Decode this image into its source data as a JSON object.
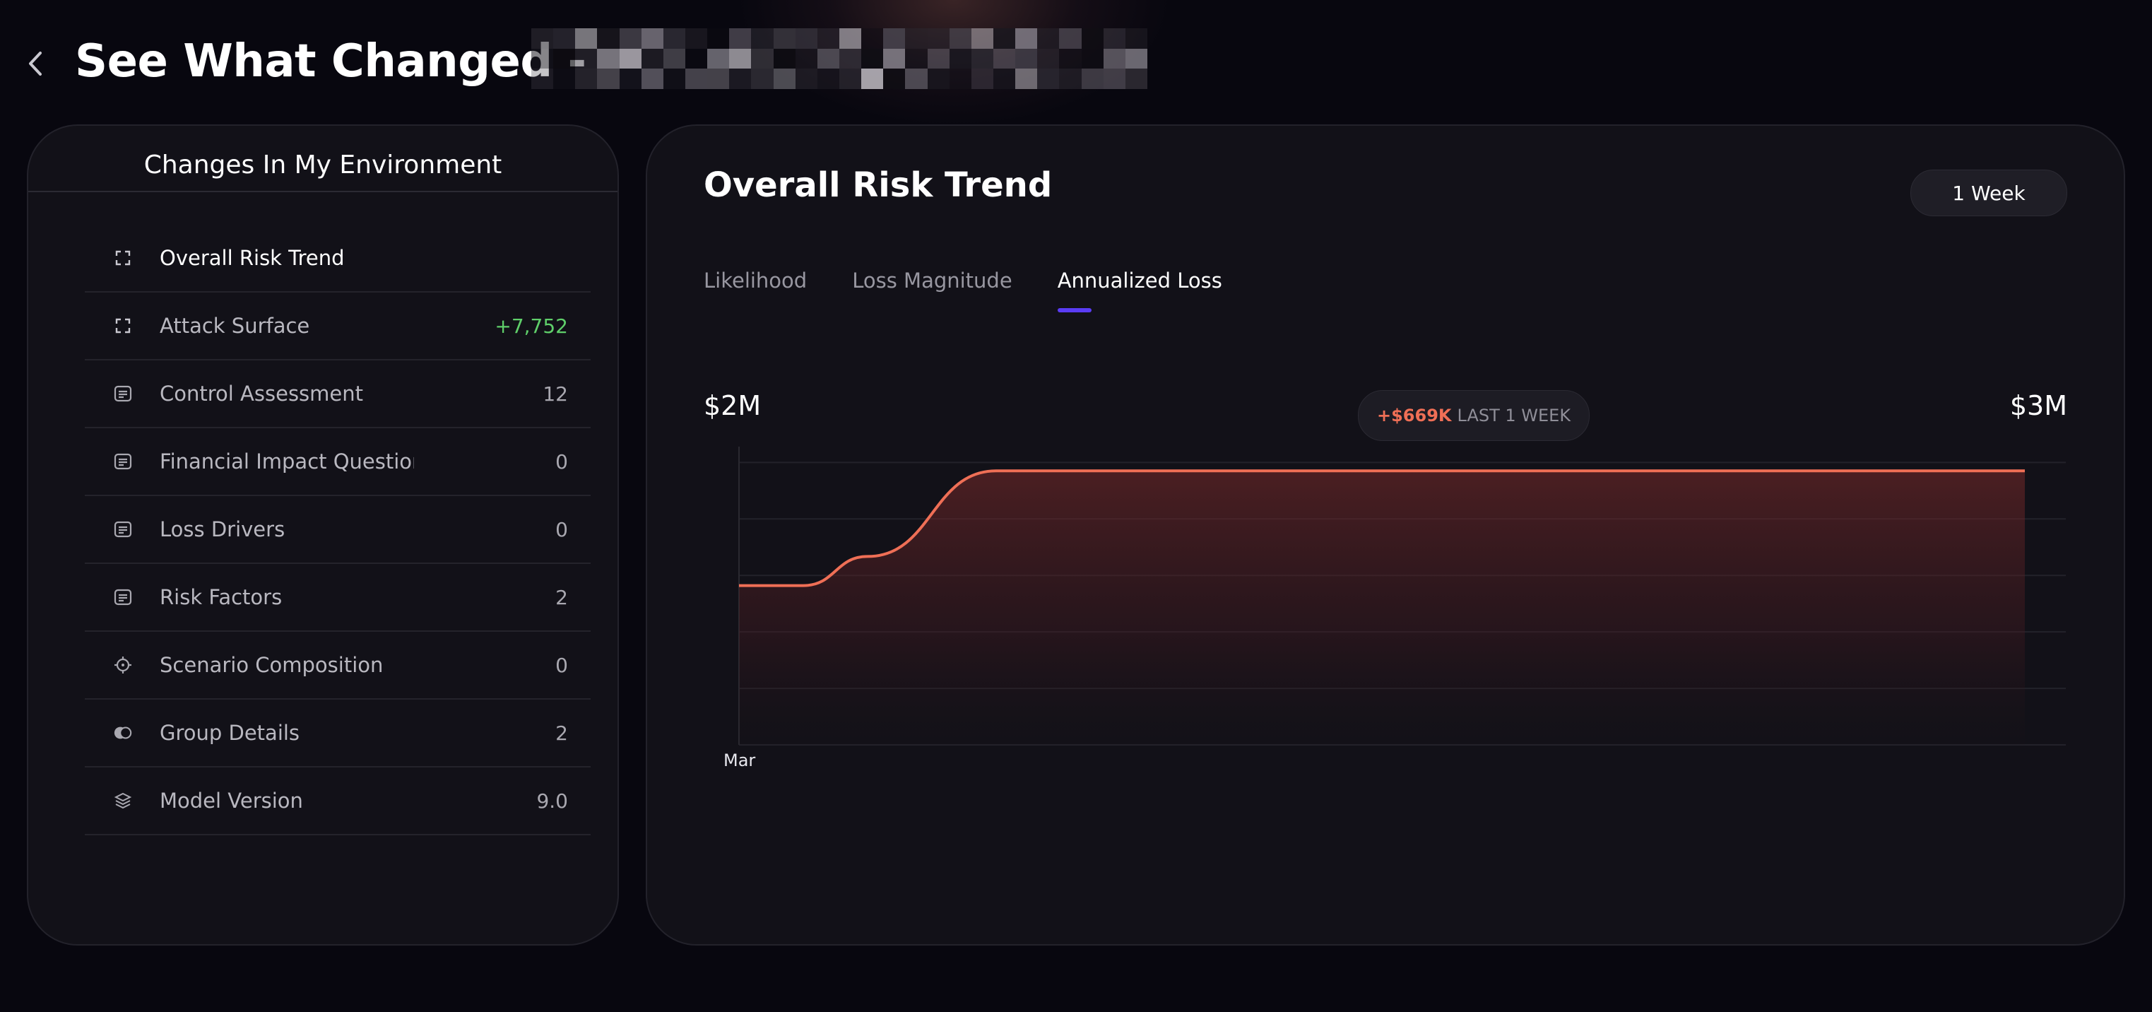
{
  "header": {
    "title": "See What Changed -"
  },
  "sidebar": {
    "title": "Changes In My Environment",
    "items": [
      {
        "label": "Overall Risk Trend",
        "value": "",
        "icon": "expand-icon",
        "active": true
      },
      {
        "label": "Attack Surface",
        "value": "+7,752",
        "icon": "expand-icon",
        "positive": true
      },
      {
        "label": "Control Assessment",
        "value": "12",
        "icon": "document-list-icon"
      },
      {
        "label": "Financial Impact Questionnaire",
        "value": "0",
        "icon": "document-list-icon"
      },
      {
        "label": "Loss Drivers",
        "value": "0",
        "icon": "document-list-icon"
      },
      {
        "label": "Risk Factors",
        "value": "2",
        "icon": "document-list-icon"
      },
      {
        "label": "Scenario Composition",
        "value": "0",
        "icon": "crosshair-icon"
      },
      {
        "label": "Group Details",
        "value": "2",
        "icon": "toggle-icon"
      },
      {
        "label": "Model Version",
        "value": "9.0",
        "icon": "layers-icon"
      }
    ]
  },
  "main": {
    "title": "Overall Risk Trend",
    "period": "1 Week",
    "tabs": [
      {
        "label": "Likelihood"
      },
      {
        "label": "Loss Magnitude"
      },
      {
        "label": "Annualized Loss",
        "active": true
      }
    ],
    "delta": {
      "value": "+$669K",
      "label": "LAST 1 WEEK"
    }
  },
  "colors": {
    "accent": "#5a3cf5",
    "line": "#ef6f56",
    "positive": "#5fcf6a"
  },
  "chart_data": {
    "type": "area",
    "y_start_label": "$2M",
    "y_end_label": "$3M",
    "x_tick_labels": [
      "Mar"
    ],
    "x": [
      0,
      0.05,
      0.1,
      0.2,
      0.3,
      0.4,
      0.5,
      0.6,
      0.7,
      0.8,
      0.9,
      1.0
    ],
    "values": [
      2.23,
      2.23,
      2.4,
      2.9,
      2.9,
      2.9,
      2.9,
      2.9,
      2.9,
      2.9,
      2.9,
      2.9
    ],
    "y_unit": "$M",
    "ylim": [
      1.3,
      3.0
    ],
    "grid": true,
    "delta": "+$669K",
    "period": "LAST 1 WEEK"
  }
}
